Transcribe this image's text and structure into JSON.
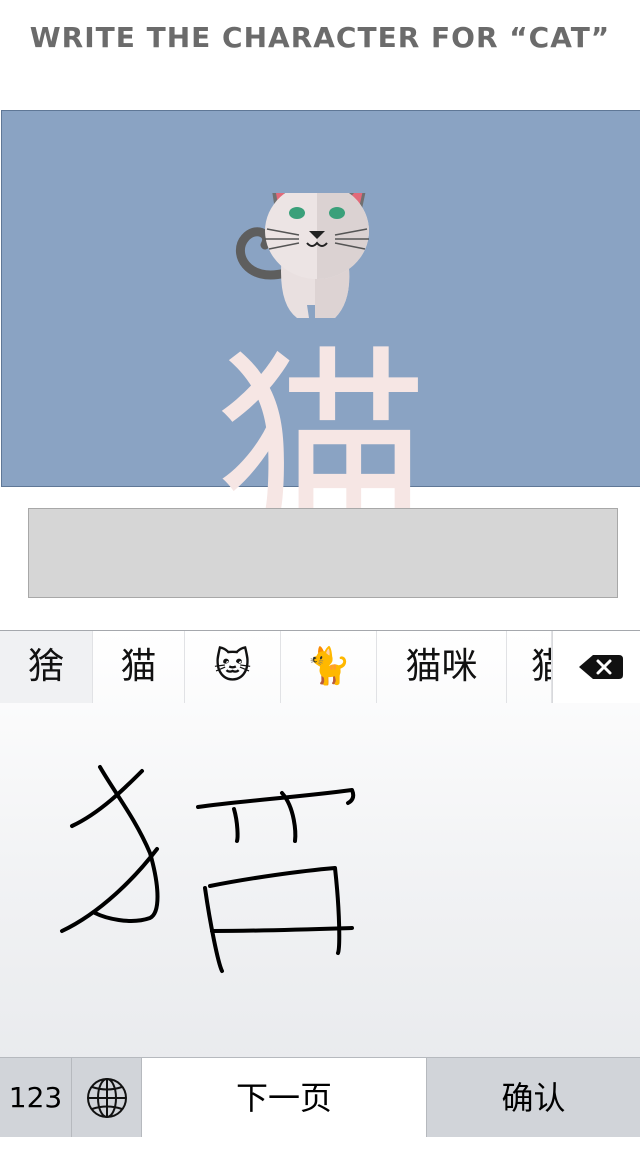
{
  "prompt": "WRITE THE CHARACTER FOR “CAT”",
  "card": {
    "character": "猫",
    "background": "#8aa3c3",
    "character_color": "#f6e6e4",
    "illustration": "cat-face-icon"
  },
  "answer_box": {
    "value": ""
  },
  "keyboard": {
    "candidates": [
      "猞",
      "猫",
      "🐱",
      "🐈",
      "猫咪",
      "猫"
    ],
    "delete_icon": "backspace-icon",
    "bottom": {
      "numbers_label": "123",
      "globe_icon": "globe-icon",
      "next_page_label": "下一页",
      "confirm_label": "确认"
    }
  }
}
